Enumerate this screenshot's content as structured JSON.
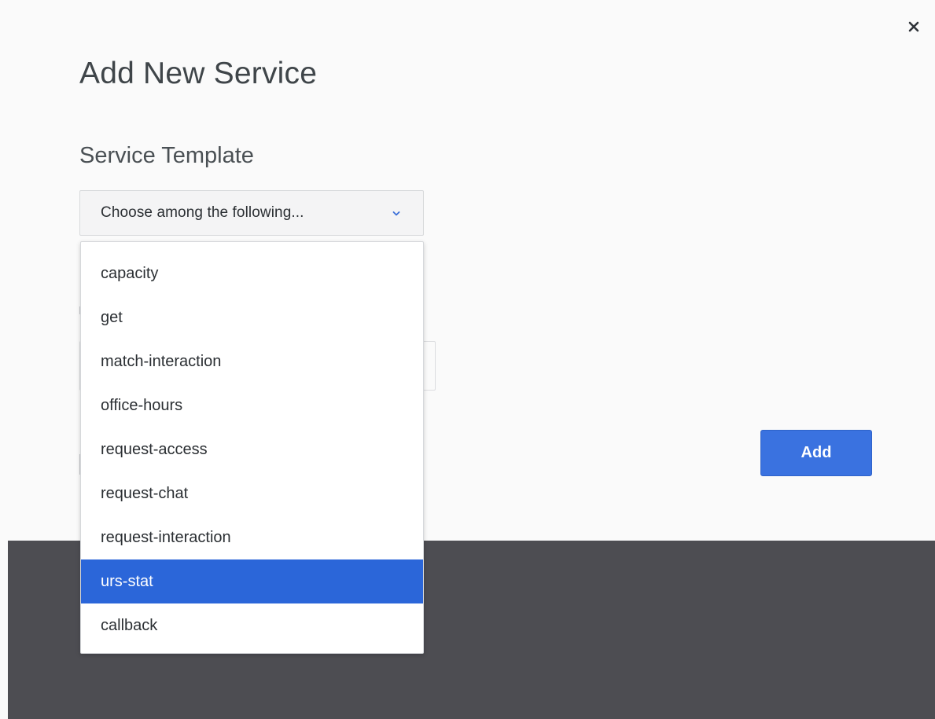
{
  "dialog": {
    "title": "Add New Service",
    "close_icon": "close-icon",
    "section_label": "Service Template",
    "select": {
      "placeholder": "Choose among the following...",
      "chevron_icon": "chevron-down-icon"
    },
    "add_label": "Add",
    "options": [
      {
        "label": "capacity"
      },
      {
        "label": "get"
      },
      {
        "label": "match-interaction"
      },
      {
        "label": "office-hours"
      },
      {
        "label": "request-access"
      },
      {
        "label": "request-chat"
      },
      {
        "label": "request-interaction"
      },
      {
        "label": "urs-stat",
        "highlighted": true
      },
      {
        "label": "callback"
      }
    ]
  },
  "colors": {
    "accent": "#2b66d9",
    "button": "#3a72e0",
    "backdrop": "#4d4d52",
    "dialog_bg": "#fafafa"
  }
}
